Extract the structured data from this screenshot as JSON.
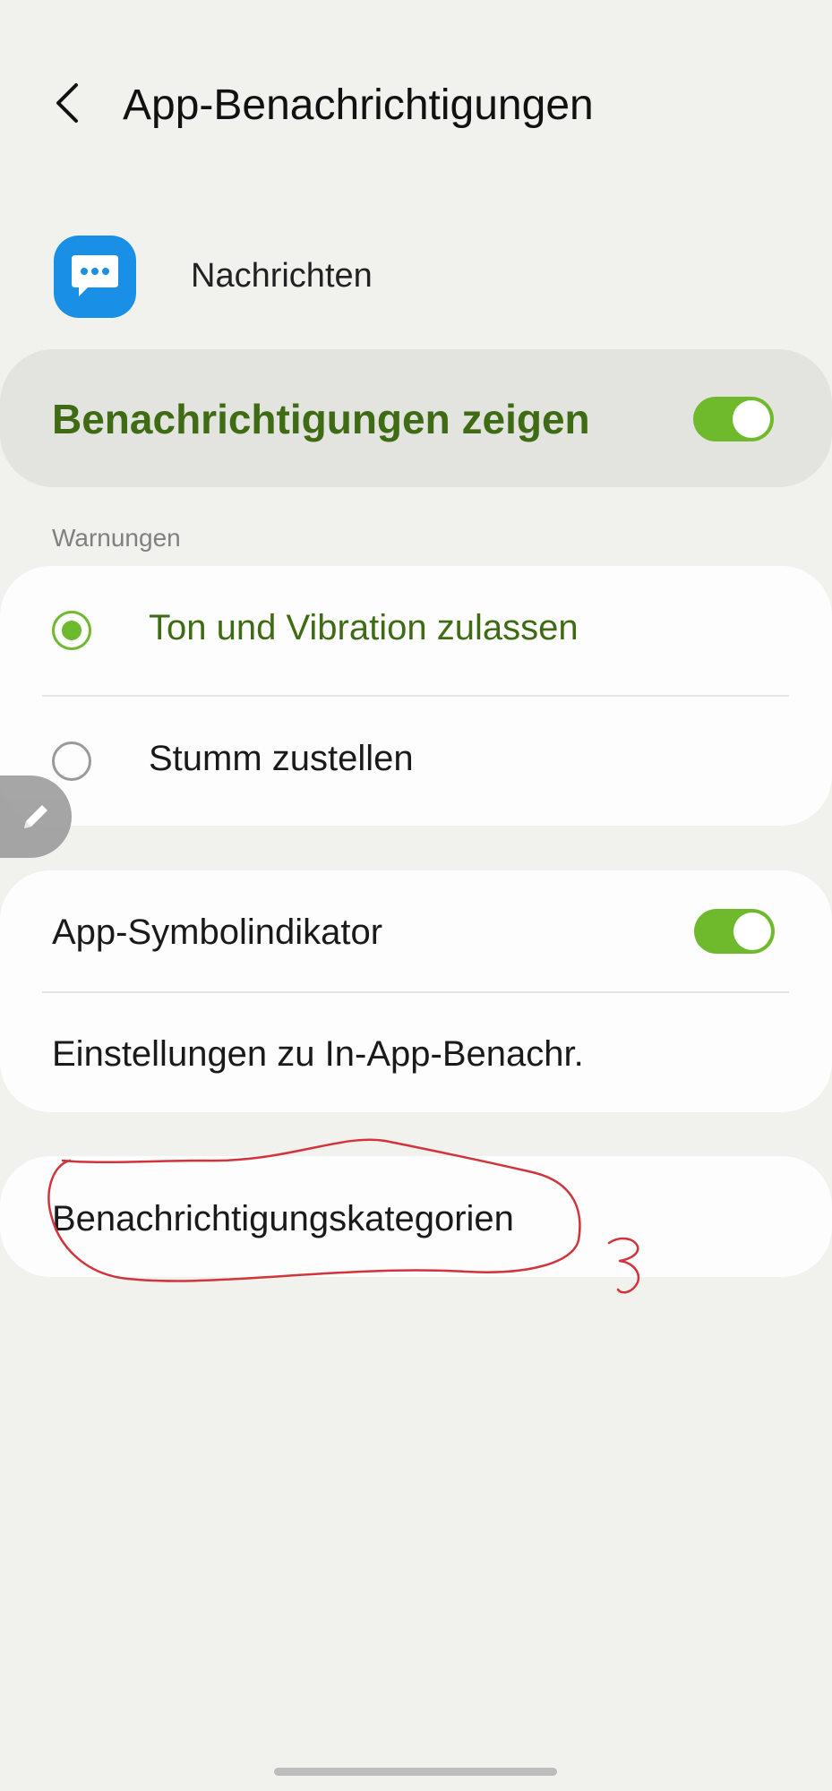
{
  "header": {
    "title": "App-Benachrichtigungen"
  },
  "app": {
    "name": "Nachrichten"
  },
  "master_toggle": {
    "label": "Benachrichtigungen zeigen",
    "enabled": true
  },
  "alerts": {
    "section_label": "Warnungen",
    "options": [
      {
        "label": "Ton und Vibration zulassen",
        "selected": true
      },
      {
        "label": "Stumm zustellen",
        "selected": false
      }
    ]
  },
  "settings": {
    "badge_label": "App-Symbolindikator",
    "badge_enabled": true,
    "in_app_label": "Einstellungen zu In-App-Benachr."
  },
  "categories": {
    "label": "Benachrichtigungskategorien"
  },
  "annotation": {
    "number": "3"
  },
  "colors": {
    "accent": "#6fba2c",
    "accent_text": "#3e6b14",
    "app_icon": "#1a8fe6",
    "annotation": "#d2343b"
  }
}
